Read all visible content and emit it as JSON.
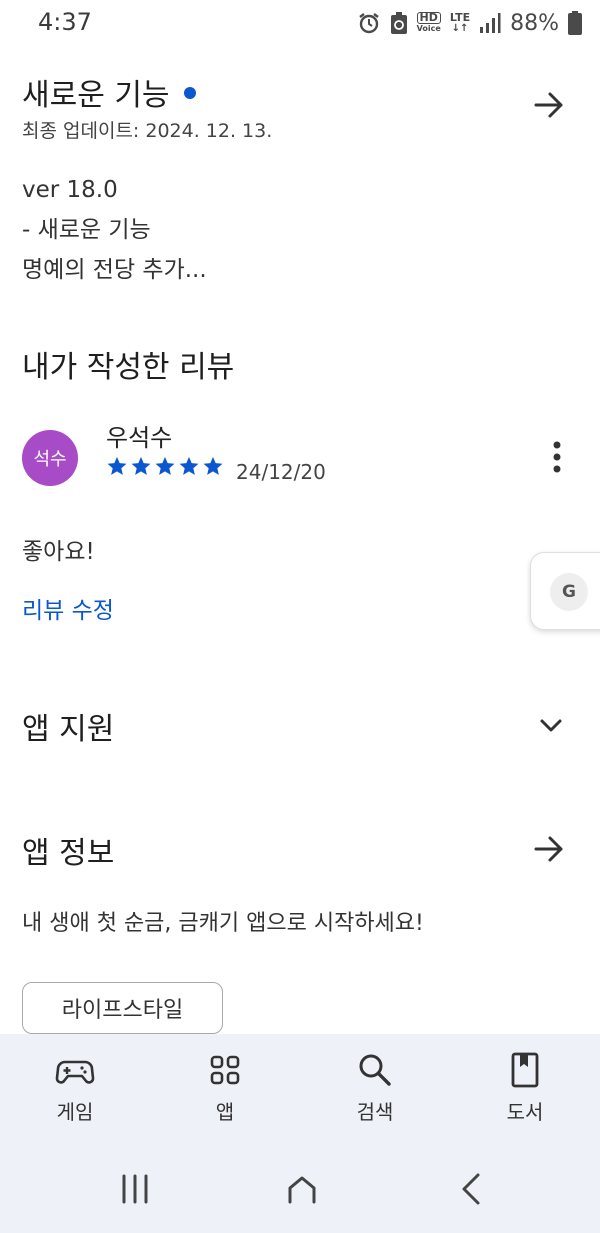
{
  "status": {
    "time": "4:37",
    "hd": "HD",
    "voice": "Voice",
    "lte": "LTE",
    "battery": "88%"
  },
  "whats_new": {
    "title": "새로운 기능",
    "updated": "최종 업데이트: 2024. 12. 13.",
    "lines": [
      "ver 18.0",
      "- 새로운 기능",
      "명예의 전당 추가..."
    ]
  },
  "my_review": {
    "heading": "내가 작성한 리뷰",
    "avatar_text": "석수",
    "author": "우석수",
    "rating": 5,
    "date": "24/12/20",
    "text": "좋아요!",
    "edit_link": "리뷰 수정"
  },
  "floating": {
    "badge": "G"
  },
  "app_support": {
    "title": "앱 지원"
  },
  "app_info": {
    "title": "앱 정보",
    "description": "내 생애 첫 순금, 금캐기 앱으로 시작하세요!",
    "chip": "라이프스타일"
  },
  "bottom_nav": {
    "items": [
      {
        "label": "게임",
        "icon": "gamepad-icon"
      },
      {
        "label": "앱",
        "icon": "apps-grid-icon"
      },
      {
        "label": "검색",
        "icon": "search-icon"
      },
      {
        "label": "도서",
        "icon": "book-icon"
      }
    ]
  },
  "colors": {
    "accent": "#0b57d0",
    "avatar": "#a84bc7",
    "nav_bg": "#eef1f8"
  }
}
